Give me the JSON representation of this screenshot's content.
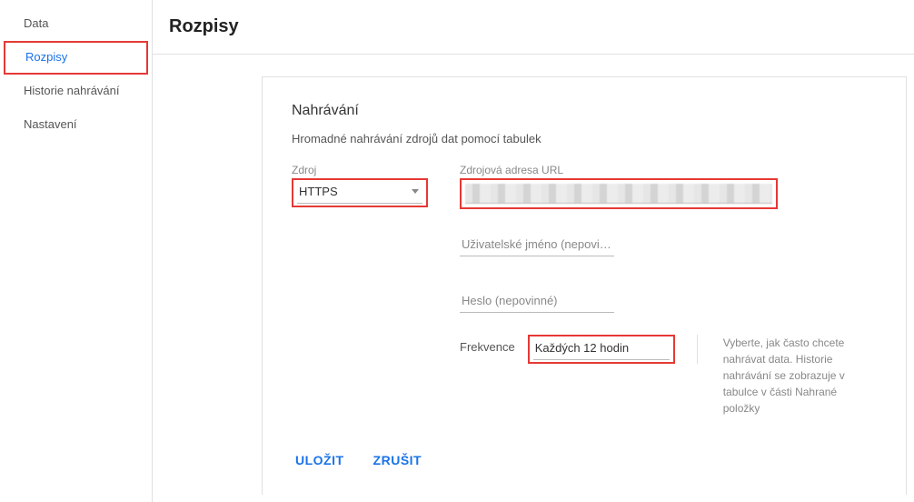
{
  "sidebar": {
    "items": [
      {
        "label": "Data"
      },
      {
        "label": "Rozpisy"
      },
      {
        "label": "Historie nahrávání"
      },
      {
        "label": "Nastavení"
      }
    ]
  },
  "header": {
    "title": "Rozpisy"
  },
  "card": {
    "title": "Nahrávání",
    "subtitle": "Hromadné nahrávání zdrojů dat pomocí tabulek",
    "source": {
      "label": "Zdroj",
      "value": "HTTPS"
    },
    "url": {
      "label": "Zdrojová adresa URL"
    },
    "username": {
      "placeholder": "Uživatelské jméno (nepovinn…"
    },
    "password": {
      "placeholder": "Heslo (nepovinné)"
    },
    "frequency": {
      "label": "Frekvence",
      "value": "Každých 12 hodin",
      "hint": "Vyberte, jak často chcete nahrávat data. Historie nahrávání se zobrazuje v tabulce v části Nahrané položky"
    }
  },
  "footer": {
    "save": "ULOŽIT",
    "cancel": "ZRUŠIT"
  }
}
